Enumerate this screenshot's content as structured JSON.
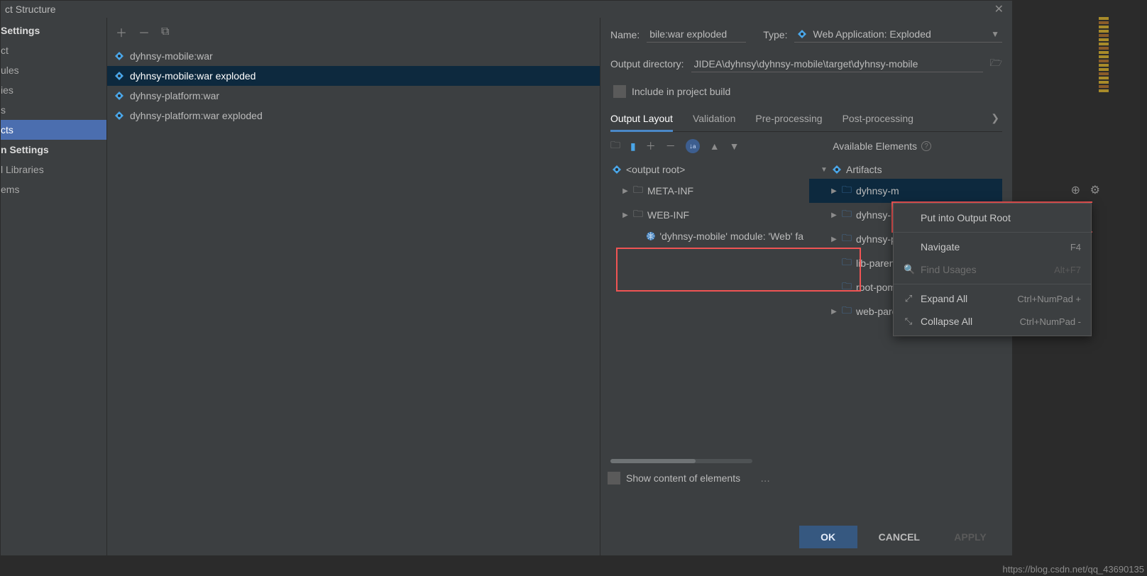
{
  "dialog": {
    "title": "ct Structure"
  },
  "sidebar": {
    "heading_settings": "Settings",
    "items_top": [
      "ct",
      "ules",
      "ies",
      "s",
      "cts"
    ],
    "selected_top_index": 4,
    "heading_platform": "n Settings",
    "items_bottom": [
      "l Libraries",
      "ems"
    ]
  },
  "artifacts_list": {
    "items": [
      "dyhnsy-mobile:war",
      "dyhnsy-mobile:war exploded",
      "dyhnsy-platform:war",
      "dyhnsy-platform:war exploded"
    ],
    "selected_index": 1
  },
  "form": {
    "name_label": "Name:",
    "name_value": "bile:war exploded",
    "type_label": "Type:",
    "type_value": "Web Application: Exploded",
    "outdir_label": "Output directory:",
    "outdir_value": "JIDEA\\dyhnsy\\dyhnsy-mobile\\target\\dyhnsy-mobile",
    "include_label": "Include in project build"
  },
  "tabs": {
    "items": [
      "Output Layout",
      "Validation",
      "Pre-processing",
      "Post-processing"
    ],
    "active_index": 0
  },
  "avail_label": "Available Elements",
  "output_tree": {
    "root": "<output root>",
    "items": [
      {
        "label": "META-INF",
        "depth": 1,
        "expand": true
      },
      {
        "label": "WEB-INF",
        "depth": 1,
        "expand": true
      },
      {
        "label": "'dyhnsy-mobile' module: 'Web' fa",
        "depth": 2,
        "expand": false,
        "facet": true
      }
    ]
  },
  "avail_tree": {
    "root": "Artifacts",
    "items": [
      {
        "label": "dyhnsy-m",
        "expand": true,
        "selected": true
      },
      {
        "label": "dyhnsy-pla",
        "expand": true
      },
      {
        "label": "dyhnsy-pla",
        "expand": true
      },
      {
        "label": "lib-parent",
        "expand": false
      },
      {
        "label": "root-pom",
        "expand": false
      },
      {
        "label": "web-parent",
        "expand": true
      }
    ]
  },
  "bottom": {
    "show_content": "Show content of elements"
  },
  "buttons": {
    "ok": "OK",
    "cancel": "CANCEL",
    "apply": "APPLY"
  },
  "context_menu": {
    "items": [
      {
        "label": "Put into Output Root",
        "disabled": false
      },
      {
        "sep": true
      },
      {
        "label": "Navigate",
        "shortcut": "F4",
        "disabled": false
      },
      {
        "label": "Find Usages",
        "shortcut": "Alt+F7",
        "disabled": true,
        "icon": "search"
      },
      {
        "sep": true
      },
      {
        "label": "Expand All",
        "shortcut": "Ctrl+NumPad +",
        "disabled": false,
        "icon": "expand"
      },
      {
        "label": "Collapse All",
        "shortcut": "Ctrl+NumPad -",
        "disabled": false,
        "icon": "collapse"
      }
    ]
  },
  "watermark": "https://blog.csdn.net/qq_43690135"
}
